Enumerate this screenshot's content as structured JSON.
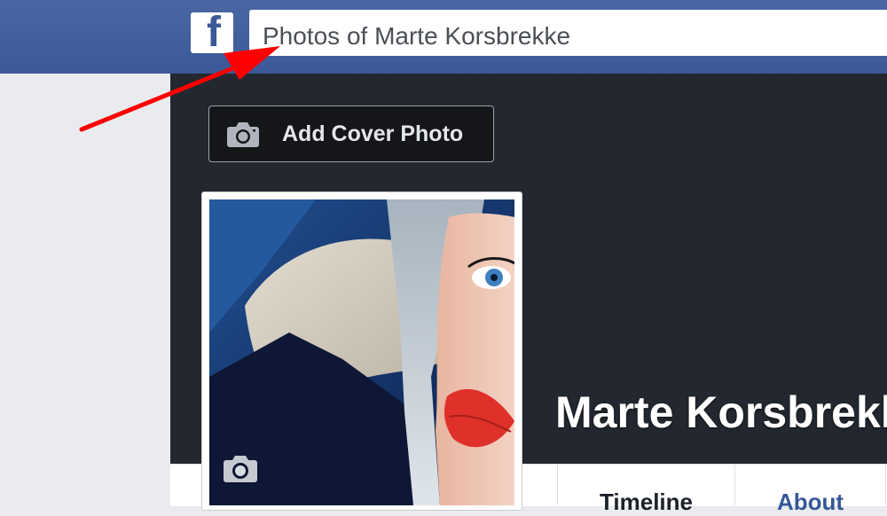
{
  "header": {
    "logo_letter": "f",
    "search_value": "Photos of Marte Korsbrekke"
  },
  "cover": {
    "add_cover_label": "Add Cover Photo"
  },
  "profile": {
    "name": "Marte Korsbrekke"
  },
  "tabs": {
    "timeline": "Timeline",
    "about": "About"
  },
  "icons": [
    "facebook-logo",
    "camera-icon",
    "profile-camera-icon",
    "annotation-arrow"
  ],
  "colors": {
    "facebook_blue": "#3b5998",
    "cover_dark": "#232830",
    "annotation_red": "#ff0000"
  }
}
